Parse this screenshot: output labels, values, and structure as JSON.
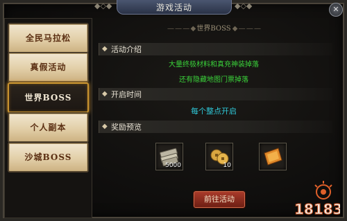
{
  "window": {
    "title": "游戏活动",
    "close_icon": "close-icon"
  },
  "sidebar": {
    "items": [
      {
        "label": "全民马拉松",
        "active": false
      },
      {
        "label": "真假活动",
        "active": false
      },
      {
        "label": "世界BOSS",
        "active": true
      },
      {
        "label": "个人副本",
        "active": false
      },
      {
        "label": "沙城BOSS",
        "active": false
      }
    ]
  },
  "main": {
    "subtitle": "世界BOSS",
    "intro": {
      "heading": "活动介绍",
      "lines": [
        "大量终极材料和真充神装掉落",
        "还有隐藏地图门票掉落"
      ]
    },
    "time": {
      "heading": "开启时间",
      "text": "每个整点开启"
    },
    "rewards": {
      "heading": "奖励预览",
      "items": [
        {
          "icon": "silver-ingot-icon",
          "qty": "5000"
        },
        {
          "icon": "gold-coin-icon",
          "qty": "10"
        },
        {
          "icon": "ticket-scroll-icon",
          "qty": ""
        }
      ]
    },
    "go_button": "前往活动"
  },
  "watermark": {
    "text": "18183"
  },
  "colors": {
    "accent_active": "#c8932f",
    "green_text": "#3ad13a",
    "cyan_text": "#2fc7d8"
  }
}
